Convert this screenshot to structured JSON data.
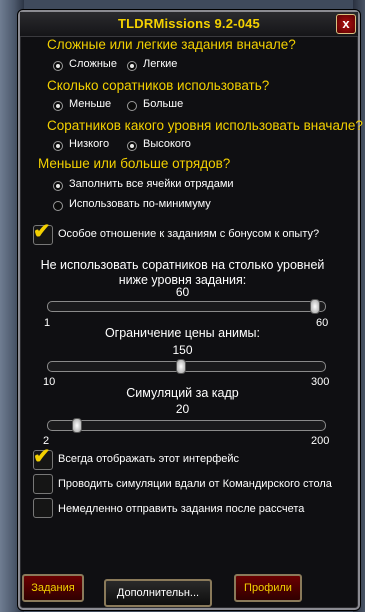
{
  "window": {
    "title": "TLDRMissions 9.2-045",
    "close_label": "x"
  },
  "difficulty": {
    "question": "Сложные или легкие задания вначале?",
    "options": [
      {
        "label": "Сложные",
        "selected": false
      },
      {
        "label": "Легкие",
        "selected": true
      }
    ]
  },
  "followers_count": {
    "question": "Сколько соратников использовать?",
    "options": [
      {
        "label": "Меньше",
        "selected": true
      },
      {
        "label": "Больше",
        "selected": false
      }
    ]
  },
  "followers_level": {
    "question": "Соратников какого уровня использовать вначале?",
    "options": [
      {
        "label": "Низкого",
        "selected": true
      },
      {
        "label": "Высокого",
        "selected": false
      }
    ]
  },
  "troops": {
    "question": "Меньше или больше отрядов?",
    "options": [
      {
        "label": "Заполнить все ячейки отрядами",
        "selected": false
      },
      {
        "label": "Использовать по-минимуму",
        "selected": false
      }
    ]
  },
  "xp_bonus": {
    "label": "Особое отношение к заданиям с бонусом к опыту?",
    "checked": true
  },
  "level_slider": {
    "label_line1": "Не использовать соратников на столько уровней",
    "label_line2": "ниже уровня задания:",
    "value": "60",
    "min": "1",
    "max": "60",
    "fraction": 0.98
  },
  "anima_slider": {
    "label": "Ограничение цены анимы:",
    "value": "150",
    "min": "10",
    "max": "300",
    "fraction": 0.48
  },
  "sim_slider": {
    "label": "Симуляций за кадр",
    "value": "20",
    "min": "2",
    "max": "200",
    "fraction": 0.09
  },
  "always_show": {
    "label": "Всегда отображать этот интерфейс",
    "checked": true
  },
  "sim_away": {
    "label": "Проводить симуляции вдали от Командирского стола",
    "checked": false
  },
  "send_immediately": {
    "label": "Немедленно отправить задания после рассчета",
    "checked": false
  },
  "tabs": [
    {
      "label": "Задания"
    },
    {
      "label": "Дополнительн..."
    },
    {
      "label": "Профили"
    }
  ],
  "colors": {
    "accent_yellow": "#f3d000",
    "tab_red": "#6a0000"
  }
}
